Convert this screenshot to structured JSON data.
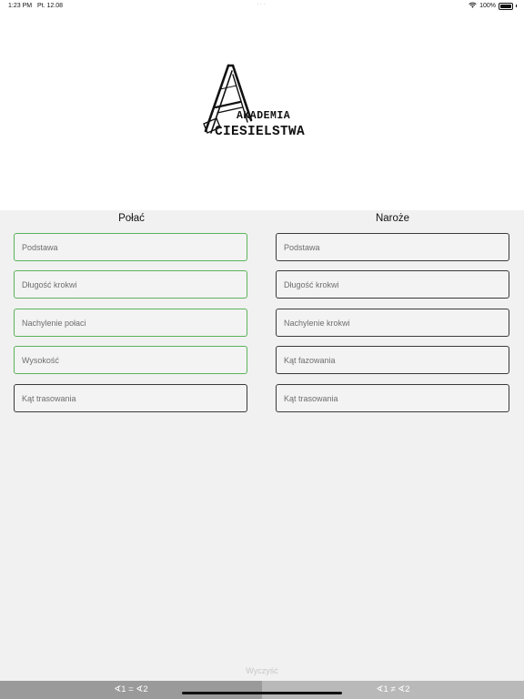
{
  "status_bar": {
    "time": "1:23 PM",
    "date": "Pt. 12.08",
    "battery": "100%",
    "dots": "···",
    "icons": [
      "wifi-icon",
      "battery-icon"
    ]
  },
  "logo": {
    "line1": "AKADEMIA",
    "line2": "CIESIELSTWA"
  },
  "columns": {
    "left": {
      "title": "Połać",
      "fields": [
        {
          "placeholder": "Podstawa",
          "value": ""
        },
        {
          "placeholder": "Długość krokwi",
          "value": ""
        },
        {
          "placeholder": "Nachylenie połaci",
          "value": ""
        },
        {
          "placeholder": "Wysokość",
          "value": ""
        },
        {
          "placeholder": "Kąt trasowania",
          "value": ""
        }
      ]
    },
    "right": {
      "title": "Naroże",
      "fields": [
        {
          "placeholder": "Podstawa",
          "value": ""
        },
        {
          "placeholder": "Długość krokwi",
          "value": ""
        },
        {
          "placeholder": "Nachylenie krokwi",
          "value": ""
        },
        {
          "placeholder": "Kąt fazowania",
          "value": ""
        },
        {
          "placeholder": "Kąt trasowania",
          "value": ""
        }
      ]
    }
  },
  "clear_label": "Wyczyść",
  "tabs": [
    {
      "label": "∢1 = ∢2",
      "selected": true
    },
    {
      "label": "∢1 ≠ ∢2",
      "selected": false
    }
  ],
  "colors": {
    "active_border": "#5ab35a",
    "default_border": "#3a3a3a",
    "background": "#f1f1f1",
    "header_background": "#ffffff",
    "tab_selected": "#9a9a9a",
    "tab_unselected": "#b9b9b9"
  }
}
